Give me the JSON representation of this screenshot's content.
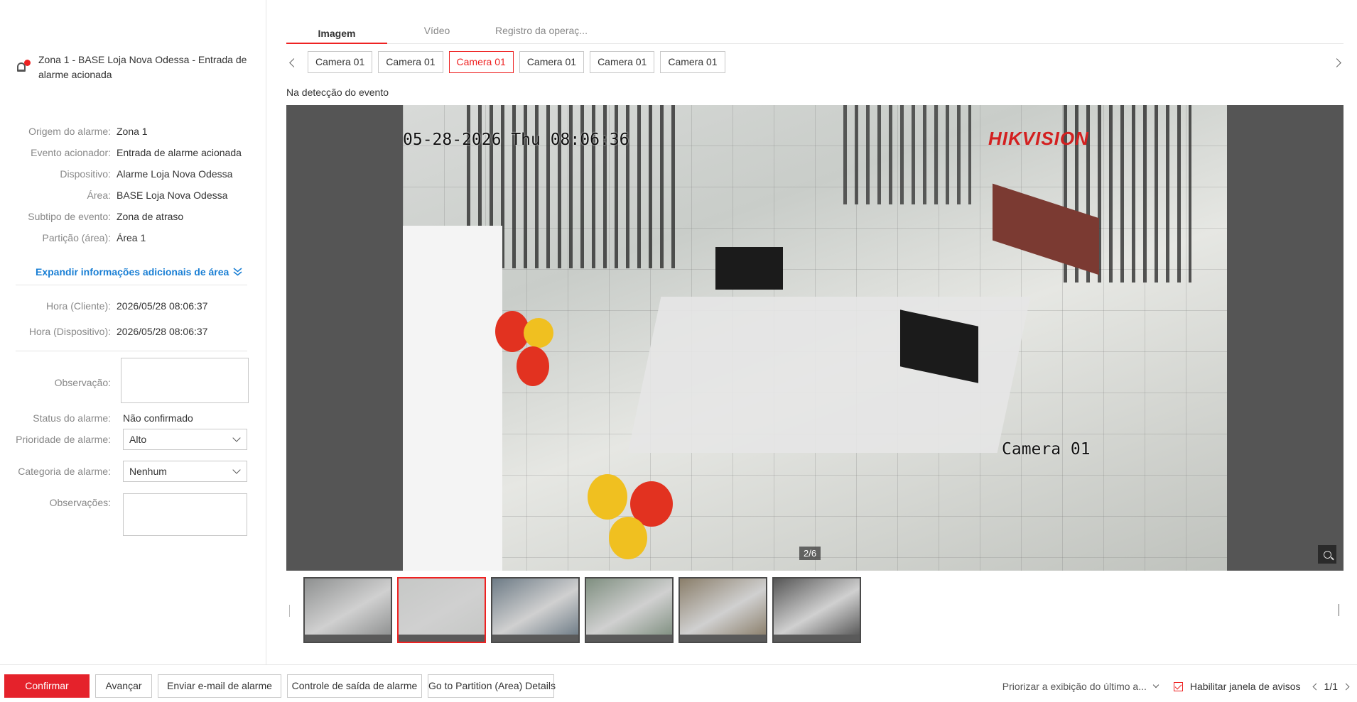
{
  "alarm": {
    "title": "Zona 1 - BASE Loja Nova Odessa - Entrada de alarme acionada"
  },
  "details": [
    {
      "label": "Origem do alarme:",
      "value": "Zona 1"
    },
    {
      "label": "Evento acionador:",
      "value": "Entrada de alarme acionada"
    },
    {
      "label": "Dispositivo:",
      "value": "Alarme Loja Nova Odessa"
    },
    {
      "label": "Área:",
      "value": "BASE Loja Nova Odessa"
    },
    {
      "label": "Subtipo de evento:",
      "value": "Zona de atraso"
    },
    {
      "label": "Partição (área):",
      "value": "Área 1"
    }
  ],
  "expand_link": "Expandir informações adicionais de área",
  "times": {
    "client_label": "Hora (Cliente):",
    "client_value": "2026/05/28 08:06:37",
    "device_label": "Hora (Dispositivo):",
    "device_value": "2026/05/28 08:06:37"
  },
  "form": {
    "observacao_label": "Observação:",
    "status_label": "Status do alarme:",
    "status_value": "Não confirmado",
    "priority_label": "Prioridade de alarme:",
    "priority_value": "Alto",
    "category_label": "Categoria de alarme:",
    "category_value": "Nenhum",
    "observacoes_label": "Observações:"
  },
  "tabs": [
    {
      "label": "Imagem",
      "active": true
    },
    {
      "label": "Vídeo",
      "active": false
    },
    {
      "label": "Registro da operaç...",
      "active": false
    }
  ],
  "cameras": [
    {
      "label": "Camera 01",
      "active": false
    },
    {
      "label": "Camera 01",
      "active": false
    },
    {
      "label": "Camera 01",
      "active": true
    },
    {
      "label": "Camera 01",
      "active": false
    },
    {
      "label": "Camera 01",
      "active": false
    },
    {
      "label": "Camera 01",
      "active": false
    }
  ],
  "event_caption": "Na detecção do evento",
  "viewer": {
    "timestamp": "05-28-2026 Thu 08:06:36",
    "brand": "HIKVISION",
    "camera_label": "Camera 01",
    "counter": "2/6"
  },
  "thumbnails": [
    {
      "active": false,
      "tone": "#8e9090"
    },
    {
      "active": true,
      "tone": "#c6c8c6"
    },
    {
      "active": false,
      "tone": "#6d7b86"
    },
    {
      "active": false,
      "tone": "#7f8f80"
    },
    {
      "active": false,
      "tone": "#8a7e6a"
    },
    {
      "active": false,
      "tone": "#565656"
    }
  ],
  "bottom": {
    "confirm": "Confirmar",
    "next": "Avançar",
    "email": "Enviar e-mail de alarme",
    "output": "Controle de saída de alarme",
    "partition": "Go to Partition (Area) Details",
    "priority_display": "Priorizar a exibição do último a...",
    "enable_popup": "Habilitar janela de avisos",
    "pager": "1/1"
  },
  "colors": {
    "accent": "#e5222b",
    "link": "#1a7fd4"
  }
}
